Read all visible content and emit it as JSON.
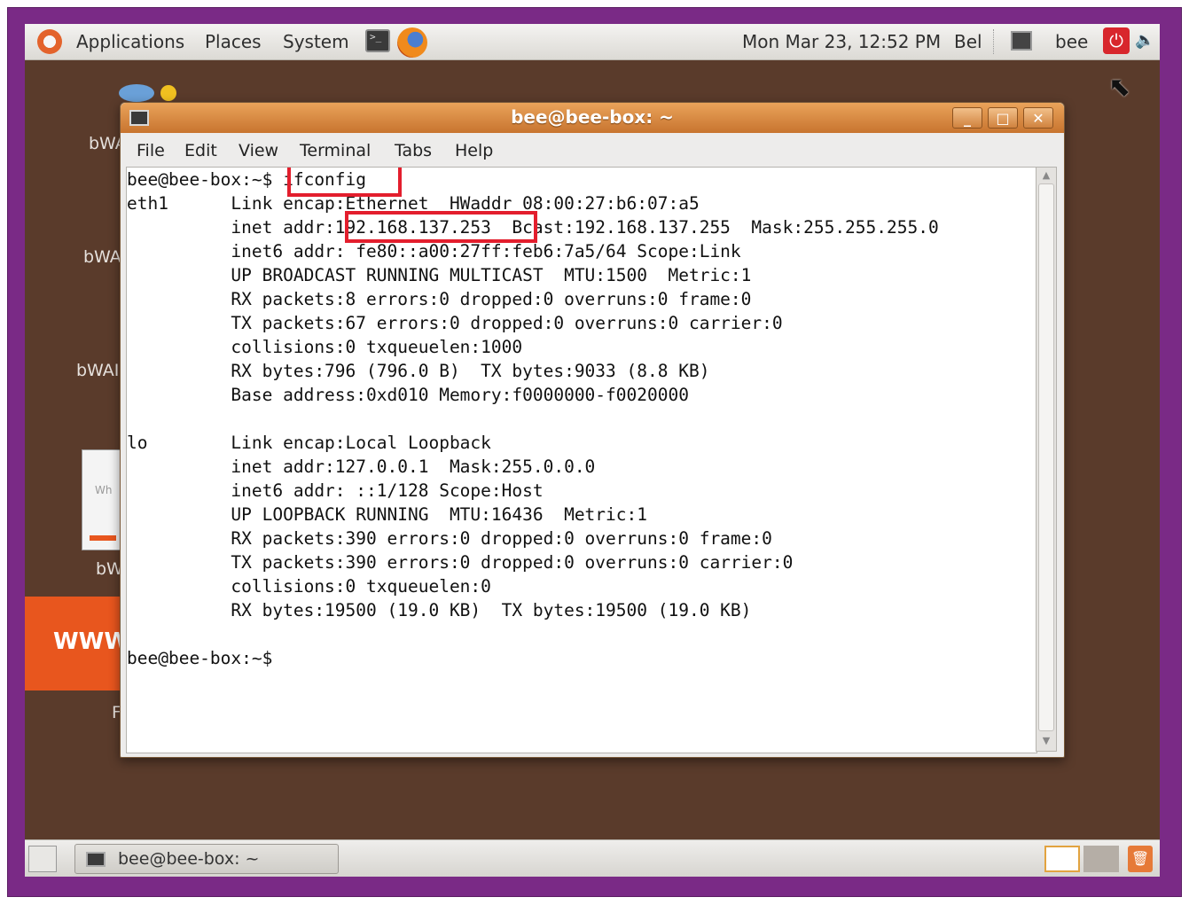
{
  "top_panel": {
    "menus": [
      "Applications",
      "Places",
      "System"
    ],
    "clock": "Mon Mar 23, 12:52 PM",
    "keyboard": "Bel",
    "user": "bee",
    "power_glyph": "⏻",
    "speaker_glyph": "🔈"
  },
  "desktop": {
    "icon_labels": [
      "bWA",
      "bWA",
      "bWAI",
      "bW"
    ],
    "document_text": "Wh",
    "banner_text": "WWW",
    "partial_label": "F"
  },
  "window": {
    "title": "bee@bee-box: ~",
    "buttons": {
      "minimize": "_",
      "maximize": "□",
      "close": "✕"
    },
    "menu": [
      "File",
      "Edit",
      "View",
      "Terminal",
      "Tabs",
      "Help"
    ]
  },
  "terminal": {
    "lines": [
      "bee@bee-box:~$ ifconfig",
      "eth1      Link encap:Ethernet  HWaddr 08:00:27:b6:07:a5",
      "          inet addr:192.168.137.253  Bcast:192.168.137.255  Mask:255.255.255.0",
      "          inet6 addr: fe80::a00:27ff:feb6:7a5/64 Scope:Link",
      "          UP BROADCAST RUNNING MULTICAST  MTU:1500  Metric:1",
      "          RX packets:8 errors:0 dropped:0 overruns:0 frame:0",
      "          TX packets:67 errors:0 dropped:0 overruns:0 carrier:0",
      "          collisions:0 txqueuelen:1000",
      "          RX bytes:796 (796.0 B)  TX bytes:9033 (8.8 KB)",
      "          Base address:0xd010 Memory:f0000000-f0020000",
      "",
      "lo        Link encap:Local Loopback",
      "          inet addr:127.0.0.1  Mask:255.0.0.0",
      "          inet6 addr: ::1/128 Scope:Host",
      "          UP LOOPBACK RUNNING  MTU:16436  Metric:1",
      "          RX packets:390 errors:0 dropped:0 overruns:0 frame:0",
      "          TX packets:390 errors:0 dropped:0 overruns:0 carrier:0",
      "          collisions:0 txqueuelen:0",
      "          RX bytes:19500 (19.0 KB)  TX bytes:19500 (19.0 KB)",
      "",
      "bee@bee-box:~$"
    ]
  },
  "taskbar": {
    "task_label": "bee@bee-box: ~"
  },
  "colors": {
    "frame": "#7a2a86",
    "desktop": "#5a3b2b",
    "titlebar": "#d88b45",
    "highlight": "#e31e2d"
  }
}
